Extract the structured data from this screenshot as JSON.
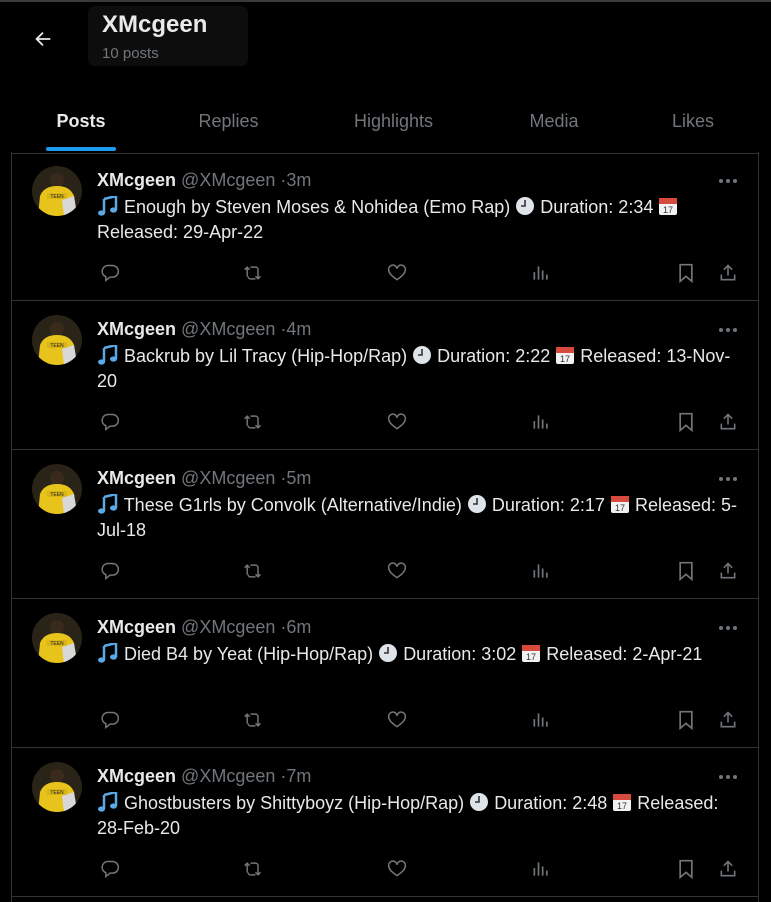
{
  "header": {
    "title": "XMcgeen",
    "post_count": "10 posts"
  },
  "tabs": [
    {
      "label": "Posts",
      "active": true
    },
    {
      "label": "Replies",
      "active": false
    },
    {
      "label": "Highlights",
      "active": false
    },
    {
      "label": "Media",
      "active": false
    },
    {
      "label": "Likes",
      "active": false
    }
  ],
  "colors": {
    "accent": "#1d9bf0",
    "muted": "#71767b",
    "text": "#e7e9ea",
    "divider": "#2f3336"
  },
  "icons": {
    "back": "arrow-left-icon",
    "more": "more-horizontal-icon",
    "reply": "reply-icon",
    "repost": "repost-icon",
    "like": "heart-icon",
    "views": "views-icon",
    "bookmark": "bookmark-icon",
    "share": "share-icon",
    "music": "music-note-icon",
    "clock": "clock-icon",
    "calendar": "calendar-icon"
  },
  "posts": [
    {
      "author": "XMcgeen",
      "handle": "@XMcgeen",
      "time": "3m",
      "song": "Enough by Steven Moses & Nohidea (Emo Rap)",
      "duration": "Duration: 2:34",
      "released": "Released: 29-Apr-22"
    },
    {
      "author": "XMcgeen",
      "handle": "@XMcgeen",
      "time": "4m",
      "song": "Backrub by Lil Tracy (Hip-Hop/Rap)",
      "duration": "Duration: 2:22",
      "released": "Released: 13-Nov-20"
    },
    {
      "author": "XMcgeen",
      "handle": "@XMcgeen",
      "time": "5m",
      "song": "These G1rls by Convolk (Alternative/Indie)",
      "duration": "Duration: 2:17",
      "released": "Released: 5-Jul-18"
    },
    {
      "author": "XMcgeen",
      "handle": "@XMcgeen",
      "time": "6m",
      "song": "Died B4 by Yeat (Hip-Hop/Rap)",
      "duration": "Duration: 3:02",
      "released": "Released: 2-Apr-21"
    },
    {
      "author": "XMcgeen",
      "handle": "@XMcgeen",
      "time": "7m",
      "song": "Ghostbusters by Shittyboyz (Hip-Hop/Rap)",
      "duration": "Duration: 2:48",
      "released": "Released: 28-Feb-20"
    }
  ]
}
